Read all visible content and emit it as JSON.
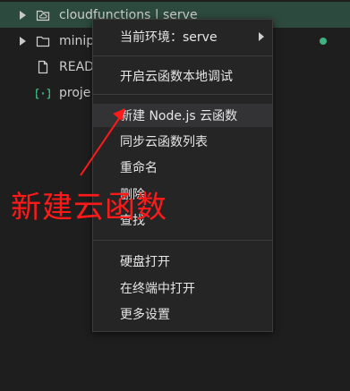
{
  "tree": {
    "items": [
      {
        "label": "cloudfunctions | serve",
        "icon": "cloud-folder-icon",
        "expandable": true
      },
      {
        "label": "minip",
        "icon": "folder-icon",
        "expandable": true
      },
      {
        "label": "READ",
        "icon": "file-icon",
        "expandable": false
      },
      {
        "label": "proje",
        "icon": "json-braces-icon",
        "expandable": false
      }
    ],
    "status_dot_color": "#3fb27f"
  },
  "context_menu": {
    "items": [
      {
        "label": "当前环境：serve",
        "submenu": true
      },
      {
        "label": "开启云函数本地调试"
      },
      {
        "label": "新建 Node.js 云函数",
        "highlighted": true
      },
      {
        "label": "同步云函数列表"
      },
      {
        "label": "重命名"
      },
      {
        "label": "删除"
      },
      {
        "label": "查找"
      },
      {
        "label": "硬盘打开"
      },
      {
        "label": "在终端中打开"
      },
      {
        "label": "更多设置"
      }
    ]
  },
  "annotation": {
    "text": "新建云函数",
    "color": "#ff1a1a"
  }
}
